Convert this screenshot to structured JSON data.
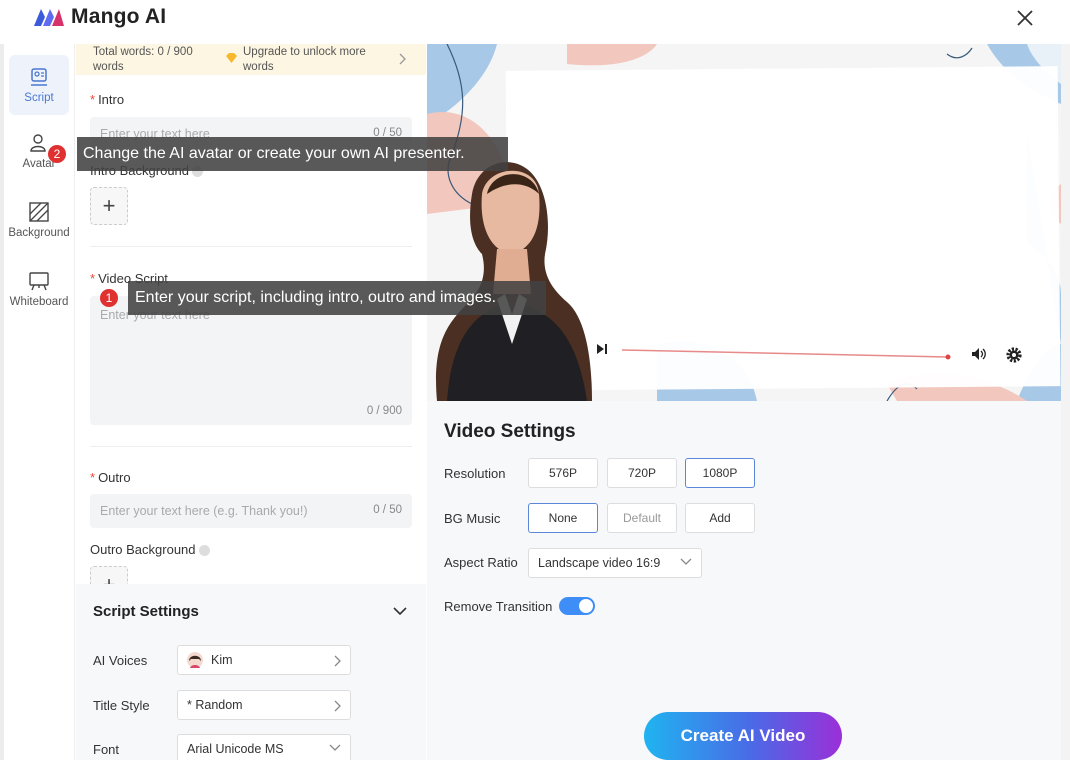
{
  "app": {
    "name": "Mango AI"
  },
  "colors": {
    "accent": "#3f8ef7",
    "selected_border": "#5b87d9",
    "required": "#e74c3c",
    "badge": "#e03131",
    "wordbar_bg": "#fdf6e3"
  },
  "icons": {
    "close": "close-icon",
    "logo": "mango-logo-icon"
  },
  "sidebar": {
    "items": [
      {
        "label": "Script",
        "icon": "script-icon",
        "active": true
      },
      {
        "label": "Avatar",
        "icon": "avatar-icon",
        "active": false
      },
      {
        "label": "Background",
        "icon": "background-icon",
        "active": false
      },
      {
        "label": "Whiteboard",
        "icon": "whiteboard-icon",
        "active": false
      }
    ]
  },
  "wordbar": {
    "total": "Total words: 0 / 900 words",
    "upgrade": "Upgrade to unlock more words"
  },
  "script": {
    "intro": {
      "label": "Intro",
      "placeholder": "Enter your text here",
      "count": "0 / 50"
    },
    "intro_bg": {
      "label": "Intro Background",
      "add": "+"
    },
    "video_script": {
      "label": "Video Script",
      "placeholder": "Enter your text here",
      "count": "0 / 900"
    },
    "outro": {
      "label": "Outro",
      "placeholder": "Enter your text here (e.g. Thank you!)",
      "count": "0 / 50"
    },
    "outro_bg": {
      "label": "Outro Background",
      "add": "+"
    }
  },
  "script_settings": {
    "title": "Script Settings",
    "rows": [
      {
        "label": "AI Voices",
        "value": "Kim"
      },
      {
        "label": "Title Style",
        "value": "* Random"
      },
      {
        "label": "Font",
        "value": "Arial Unicode MS"
      }
    ]
  },
  "video_settings": {
    "title": "Video Settings",
    "resolution": {
      "label": "Resolution",
      "options": [
        "576P",
        "720P",
        "1080P"
      ],
      "selected": "1080P"
    },
    "bg_music": {
      "label": "BG Music",
      "options": [
        "None",
        "Default",
        "Add"
      ],
      "selected": "None"
    },
    "aspect_ratio": {
      "label": "Aspect Ratio",
      "value": "Landscape video 16:9"
    },
    "remove_transition": {
      "label": "Remove Transition",
      "on": true
    }
  },
  "create_button": "Create AI Video",
  "tooltips": [
    {
      "num": "1",
      "text": "Enter your script, including intro, outro and images."
    },
    {
      "num": "2",
      "text": "Change the AI avatar or create your own AI presenter."
    }
  ]
}
